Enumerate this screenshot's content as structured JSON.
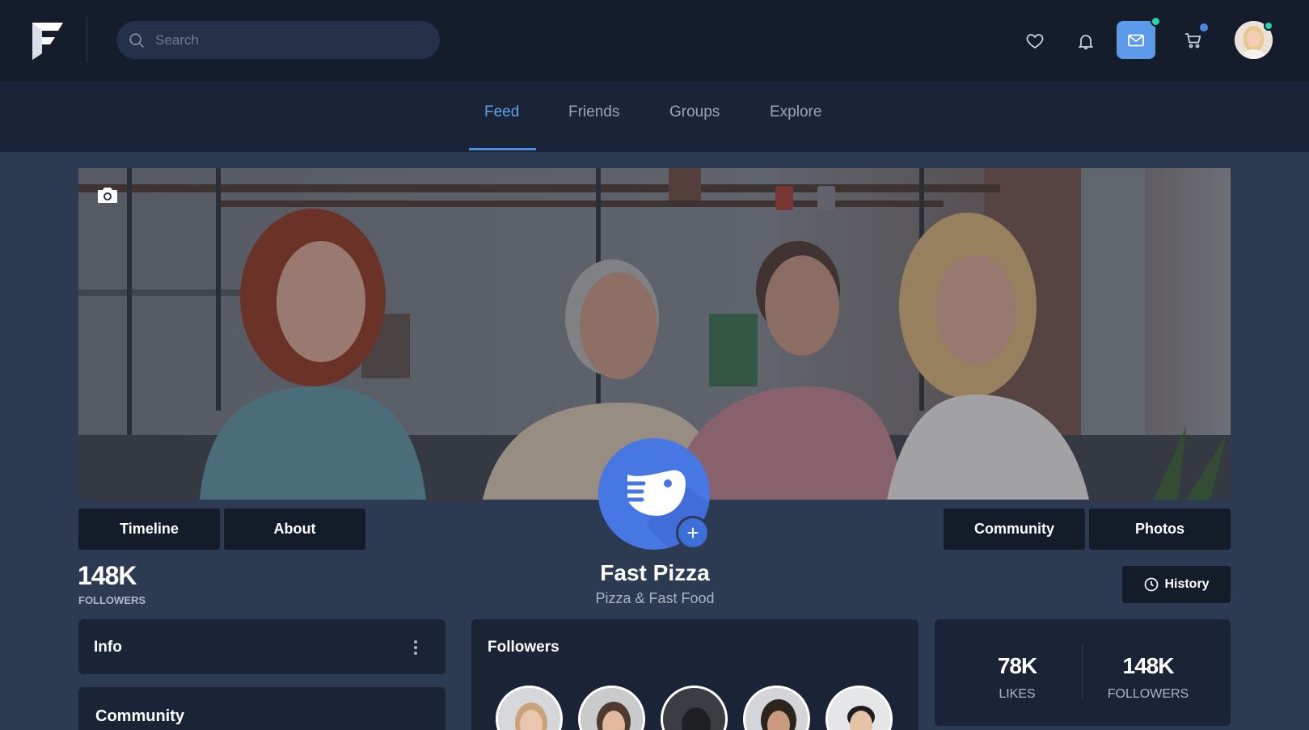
{
  "header": {
    "search_placeholder": "Search",
    "accent": "#5b9ae8",
    "notification_dot_color": "#28d1b4"
  },
  "nav": {
    "tabs": [
      {
        "label": "Feed",
        "active": true
      },
      {
        "label": "Friends",
        "active": false
      },
      {
        "label": "Groups",
        "active": false
      },
      {
        "label": "Explore",
        "active": false
      }
    ]
  },
  "profile": {
    "name": "Fast Pizza",
    "category": "Pizza & Fast Food",
    "buttons": {
      "timeline": "Timeline",
      "about": "About",
      "community": "Community",
      "photos": "Photos",
      "history": "History"
    },
    "followers_count": "148K",
    "followers_label": "FOLLOWERS"
  },
  "cards": {
    "info_title": "Info",
    "community_title": "Community",
    "followers_title": "Followers",
    "stats": {
      "likes_value": "78K",
      "likes_label": "LIKES",
      "followers_value": "148K",
      "followers_label": "FOLLOWERS"
    }
  },
  "icons": [
    "search-icon",
    "heart-icon",
    "bell-icon",
    "mail-icon",
    "cart-icon",
    "camera-icon",
    "plus-icon",
    "clock-icon",
    "kebab-icon"
  ]
}
